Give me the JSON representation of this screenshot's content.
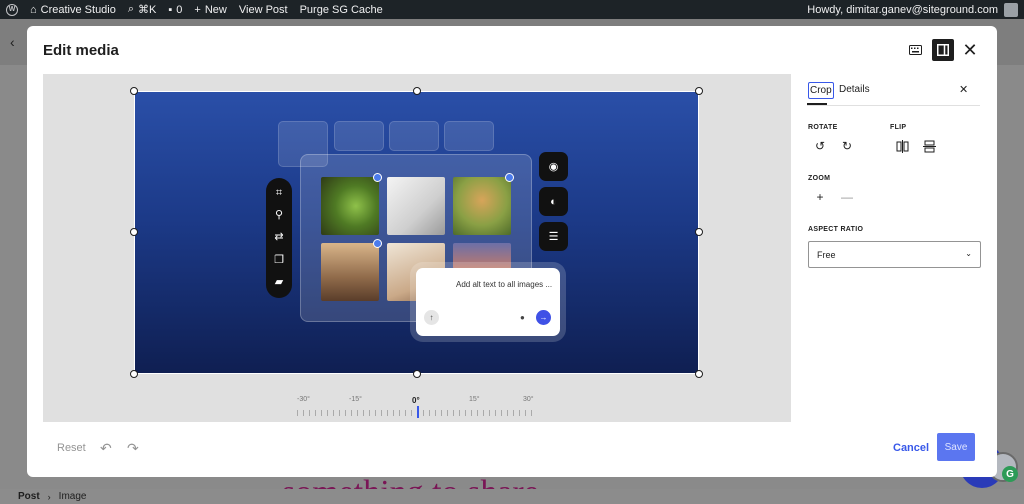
{
  "adminbar": {
    "site_name": "Creative Studio",
    "search_shortcut": "⌘K",
    "comments_count": "0",
    "new_label": "New",
    "view_post_label": "View Post",
    "purge_label": "Purge SG Cache",
    "greeting": "Howdy, dimitar.ganev@siteground.com"
  },
  "background": {
    "heading_text": "something to share",
    "breadcrumb": [
      "Post",
      "Image"
    ]
  },
  "modal": {
    "title": "Edit media",
    "image": {
      "chat_text": "Add alt text to all images ..."
    },
    "ruler": {
      "labels": [
        "-30°",
        "-15°",
        "0°",
        "15°",
        "30°"
      ],
      "current": "0°"
    },
    "footer": {
      "reset_label": "Reset",
      "cancel_label": "Cancel",
      "save_label": "Save"
    },
    "sidebar": {
      "tabs": [
        "Crop",
        "Details"
      ],
      "active_tab": "Crop",
      "rotate_label": "ROTATE",
      "flip_label": "FLIP",
      "zoom_label": "ZOOM",
      "aspect_label": "ASPECT RATIO",
      "aspect_value": "Free"
    }
  },
  "colors": {
    "accent": "#3858e9",
    "admin_bar": "#1d2327",
    "image_top": "#2a4fa8",
    "image_bottom": "#0f1f52"
  }
}
